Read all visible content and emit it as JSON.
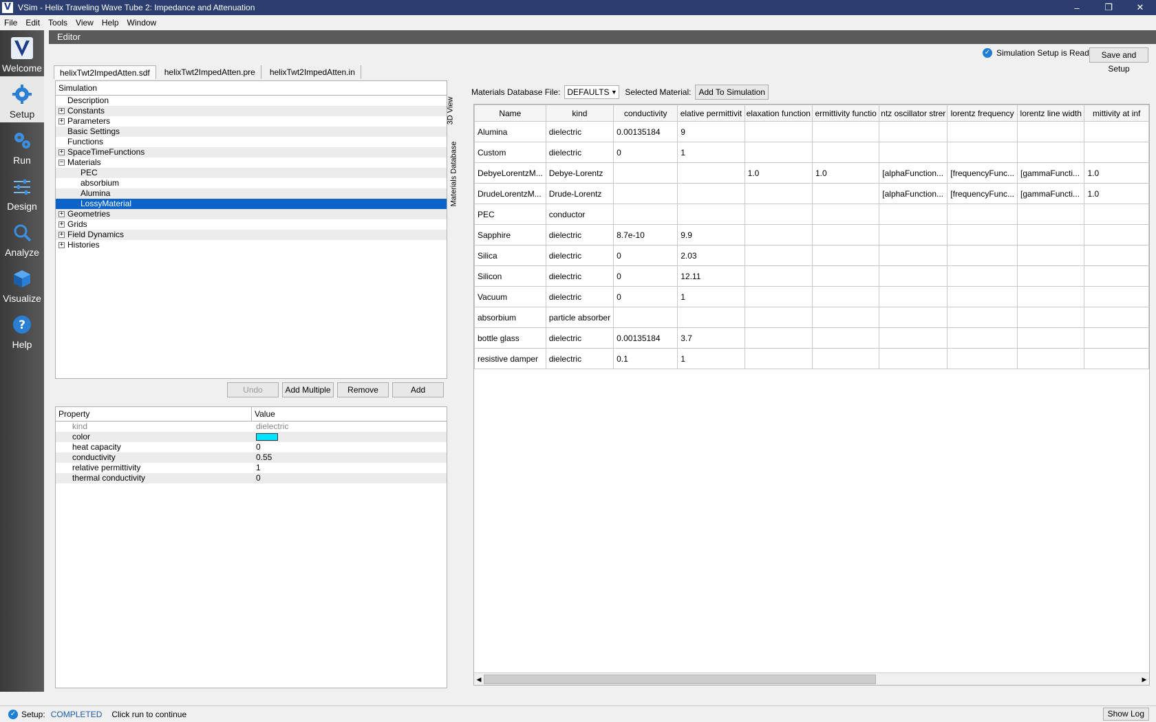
{
  "window": {
    "title": "VSim - Helix Traveling Wave Tube 2: Impedance and Attenuation",
    "app_icon": "V",
    "controls": [
      "–",
      "❐",
      "✕"
    ]
  },
  "menu": [
    "File",
    "Edit",
    "Tools",
    "View",
    "Help",
    "Window"
  ],
  "sidebar": [
    {
      "label": "Welcome",
      "icon": "vsim-logo-icon"
    },
    {
      "label": "Setup",
      "icon": "gear-icon",
      "active": true
    },
    {
      "label": "Run",
      "icon": "gears-icon"
    },
    {
      "label": "Design",
      "icon": "sliders-icon"
    },
    {
      "label": "Analyze",
      "icon": "magnifier-icon"
    },
    {
      "label": "Visualize",
      "icon": "cube-icon"
    },
    {
      "label": "Help",
      "icon": "question-icon"
    }
  ],
  "editor": {
    "header": "Editor",
    "status_text": "Simulation Setup is Ready",
    "save_button": "Save and Setup",
    "tabs": [
      "helixTwt2ImpedAtten.sdf",
      "helixTwt2ImpedAtten.pre",
      "helixTwt2ImpedAtten.in"
    ]
  },
  "tree": {
    "header": "Simulation",
    "items": [
      {
        "label": "Description",
        "level": 0,
        "exp": ""
      },
      {
        "label": "Constants",
        "level": 0,
        "exp": "+"
      },
      {
        "label": "Parameters",
        "level": 0,
        "exp": "+"
      },
      {
        "label": "Basic Settings",
        "level": 0,
        "exp": ""
      },
      {
        "label": "Functions",
        "level": 0,
        "exp": ""
      },
      {
        "label": "SpaceTimeFunctions",
        "level": 0,
        "exp": "+"
      },
      {
        "label": "Materials",
        "level": 0,
        "exp": "−"
      },
      {
        "label": "PEC",
        "level": 1,
        "exp": ""
      },
      {
        "label": "absorbium",
        "level": 1,
        "exp": ""
      },
      {
        "label": "Alumina",
        "level": 1,
        "exp": ""
      },
      {
        "label": "LossyMaterial",
        "level": 1,
        "exp": "",
        "selected": true
      },
      {
        "label": "Geometries",
        "level": 0,
        "exp": "+"
      },
      {
        "label": "Grids",
        "level": 0,
        "exp": "+"
      },
      {
        "label": "Field Dynamics",
        "level": 0,
        "exp": "+"
      },
      {
        "label": "Histories",
        "level": 0,
        "exp": "+"
      }
    ]
  },
  "tree_buttons": {
    "undo": "Undo",
    "add_multiple": "Add Multiple",
    "remove": "Remove",
    "add": "Add"
  },
  "properties": {
    "headers": [
      "Property",
      "Value"
    ],
    "rows": [
      {
        "name": "kind",
        "value": "dielectric",
        "muted": true
      },
      {
        "name": "color",
        "value": "",
        "swatch": "#00e5ff"
      },
      {
        "name": "heat capacity",
        "value": "0"
      },
      {
        "name": "conductivity",
        "value": "0.55"
      },
      {
        "name": "relative permittivity",
        "value": "1"
      },
      {
        "name": "thermal conductivity",
        "value": "0"
      }
    ]
  },
  "side_tabs": [
    "3D View",
    "Materials Database"
  ],
  "materials": {
    "db_label": "Materials Database File:",
    "db_value": "DEFAULTS",
    "selected_label": "Selected Material:",
    "add_button": "Add To Simulation",
    "columns": [
      "Name",
      "kind",
      "conductivity",
      "elative permittivit",
      "elaxation function",
      "ermittivity functio",
      "ntz oscillator strer",
      "lorentz frequency",
      "lorentz line width",
      "mittivity at inf"
    ],
    "rows": [
      [
        "Alumina",
        "dielectric",
        "0.00135184",
        "9",
        "",
        "",
        "",
        "",
        "",
        ""
      ],
      [
        "Custom",
        "dielectric",
        "0",
        "1",
        "",
        "",
        "",
        "",
        "",
        ""
      ],
      [
        "DebyeLorentzM...",
        "Debye-Lorentz",
        "",
        "",
        "1.0",
        "1.0",
        "[alphaFunction...",
        "[frequencyFunc...",
        "[gammaFuncti...",
        "1.0"
      ],
      [
        "DrudeLorentzM...",
        "Drude-Lorentz",
        "",
        "",
        "",
        "",
        "[alphaFunction...",
        "[frequencyFunc...",
        "[gammaFuncti...",
        "1.0"
      ],
      [
        "PEC",
        "conductor",
        "",
        "",
        "",
        "",
        "",
        "",
        "",
        ""
      ],
      [
        "Sapphire",
        "dielectric",
        "8.7e-10",
        "9.9",
        "",
        "",
        "",
        "",
        "",
        ""
      ],
      [
        "Silica",
        "dielectric",
        "0",
        "2.03",
        "",
        "",
        "",
        "",
        "",
        ""
      ],
      [
        "Silicon",
        "dielectric",
        "0",
        "12.11",
        "",
        "",
        "",
        "",
        "",
        ""
      ],
      [
        "Vacuum",
        "dielectric",
        "0",
        "1",
        "",
        "",
        "",
        "",
        "",
        ""
      ],
      [
        "absorbium",
        "particle absorber",
        "",
        "",
        "",
        "",
        "",
        "",
        "",
        ""
      ],
      [
        "bottle glass",
        "dielectric",
        "0.00135184",
        "3.7",
        "",
        "",
        "",
        "",
        "",
        ""
      ],
      [
        "resistive damper",
        "dielectric",
        "0.1",
        "1",
        "",
        "",
        "",
        "",
        "",
        ""
      ]
    ]
  },
  "statusbar": {
    "prefix": "Setup:",
    "state": "COMPLETED",
    "message": "Click run to continue",
    "show_log": "Show Log"
  }
}
